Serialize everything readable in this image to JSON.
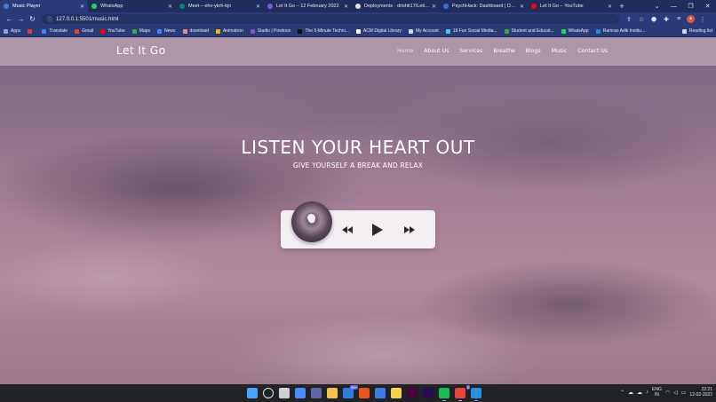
{
  "browser": {
    "tabs": [
      {
        "label": "Music Player",
        "color": "#4a7bd0",
        "active": true
      },
      {
        "label": "WhatsApp",
        "color": "#25d366",
        "active": false
      },
      {
        "label": "Meet – ehv-ykrh-kjn",
        "color": "#00897b",
        "active": false
      },
      {
        "label": "Let It Go – 12 February 2022",
        "color": "#7b5cd6",
        "active": false
      },
      {
        "label": "Deployments · drishti17/Letitgo",
        "color": "#e0e0e0",
        "active": false
      },
      {
        "label": "PsychHack: Dashboard | Devfolio",
        "color": "#3d6fe3",
        "active": false
      },
      {
        "label": "Let It Go – YouTube",
        "color": "#ff0000",
        "active": false
      }
    ],
    "url": "127.0.0.1:5501/music.html",
    "bookmarks": [
      {
        "label": "Apps",
        "color": "#8aa2e6"
      },
      {
        "label": "",
        "color": "#e53935"
      },
      {
        "label": "Translate",
        "color": "#4285f4"
      },
      {
        "label": "Gmail",
        "color": "#ea4335"
      },
      {
        "label": "YouTube",
        "color": "#ff0000"
      },
      {
        "label": "Maps",
        "color": "#34a853"
      },
      {
        "label": "News",
        "color": "#4285f4"
      },
      {
        "label": "download",
        "color": "#f28b82"
      },
      {
        "label": "Animatron",
        "color": "#f4b400"
      },
      {
        "label": "Studio | Powtoon",
        "color": "#7e57c2"
      },
      {
        "label": "The 5-Minute Techni...",
        "color": "#111111"
      },
      {
        "label": "ACM Digital Library",
        "color": "#ffffff"
      },
      {
        "label": "My Account",
        "color": "#cfd8dc"
      },
      {
        "label": "18 Fun Social Media...",
        "color": "#4fc3f7"
      },
      {
        "label": "Student and Educat...",
        "color": "#43a047"
      },
      {
        "label": "WhatsApp",
        "color": "#25d366"
      },
      {
        "label": "Ramrao Adik Institu...",
        "color": "#1e88e5"
      }
    ],
    "reading_list": "Reading list"
  },
  "site": {
    "logo": "Let It Go",
    "nav": [
      "Home",
      "About Us",
      "Services",
      "Breathe",
      "Blogs",
      "Music",
      "Contact Us"
    ],
    "hero_title": "LISTEN YOUR HEART OUT",
    "hero_subtitle": "GIVE YOURSELF A BREAK AND RELAX"
  },
  "player": {
    "controls": [
      "rewind-icon",
      "play-icon",
      "fast-forward-icon"
    ]
  },
  "taskbar": {
    "apps": [
      {
        "name": "start",
        "color": "#4aa3ff"
      },
      {
        "name": "search",
        "color": "#e6e6e6"
      },
      {
        "name": "task-view",
        "color": "#cfcfcf"
      },
      {
        "name": "widgets",
        "color": "#4a8cff"
      },
      {
        "name": "teams-chat",
        "color": "#6264a7"
      },
      {
        "name": "file-explorer",
        "color": "#f2c14e"
      },
      {
        "name": "mail",
        "color": "#2f7bd8",
        "badge": "99+"
      },
      {
        "name": "office",
        "color": "#e8551f"
      },
      {
        "name": "store",
        "color": "#3c7ee6"
      },
      {
        "name": "sticky-notes",
        "color": "#f5d34a"
      },
      {
        "name": "adobe-xd",
        "color": "#470137"
      },
      {
        "name": "premiere-pro",
        "color": "#2a0a52"
      },
      {
        "name": "spotify",
        "color": "#1db954"
      },
      {
        "name": "chrome",
        "color": "#e8453c",
        "badge": "2"
      },
      {
        "name": "vscode",
        "color": "#2a8ee0"
      }
    ],
    "language": "ENG",
    "region": "IN",
    "time": "22:21",
    "date": "12-02-2022"
  }
}
